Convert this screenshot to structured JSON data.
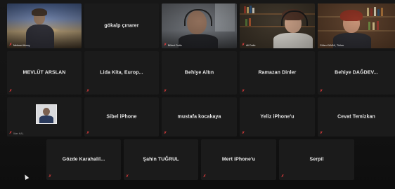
{
  "gallery": {
    "row1": [
      {
        "id": "p1",
        "video": true,
        "label": "Mehmet Aksoy",
        "muted": true
      },
      {
        "id": "p2",
        "video": false,
        "name": "gökalp çınarer",
        "muted": false
      },
      {
        "id": "p3",
        "video": true,
        "label": "Bülent Dutlu",
        "muted": true
      },
      {
        "id": "p4",
        "video": true,
        "label": "Ali Dutlu",
        "muted": true
      },
      {
        "id": "p5",
        "video": true,
        "label": "Gülen KAVAK, Türker",
        "muted": false,
        "active": true
      }
    ],
    "row2": [
      {
        "id": "p6",
        "name": "MEVLÜT ARSLAN",
        "muted": true
      },
      {
        "id": "p7",
        "name": "Lida Kita, Europ...",
        "muted": true
      },
      {
        "id": "p8",
        "name": "Behiye Altın",
        "muted": true
      },
      {
        "id": "p9",
        "name": "Ramazan Dinler",
        "muted": true
      },
      {
        "id": "p10",
        "name": "Behiye DAĞDEV...",
        "muted": true
      }
    ],
    "row3": [
      {
        "id": "p11",
        "video": true,
        "label": "İlker KAL",
        "muted": true
      },
      {
        "id": "p12",
        "name": "Sibel iPhone",
        "muted": true
      },
      {
        "id": "p13",
        "name": "mustafa kocakaya",
        "muted": true
      },
      {
        "id": "p14",
        "name": "Yeliz iPhone'u",
        "muted": true
      },
      {
        "id": "p15",
        "name": "Cevat Temizkan",
        "muted": true
      }
    ],
    "row4": [
      {
        "id": "p16",
        "name": "Gözde Karahalil...",
        "muted": true
      },
      {
        "id": "p17",
        "name": "Şahin TUĞRUL",
        "muted": true
      },
      {
        "id": "p18",
        "name": "Mert iPhone'u",
        "muted": true
      },
      {
        "id": "p19",
        "name": "Serpil",
        "muted": true
      }
    ]
  },
  "mute_glyph": "✗",
  "colors": {
    "muted_red": "#d23a3a",
    "active_border": "#d9d26a",
    "tile_bg": "#1b1b1b"
  }
}
